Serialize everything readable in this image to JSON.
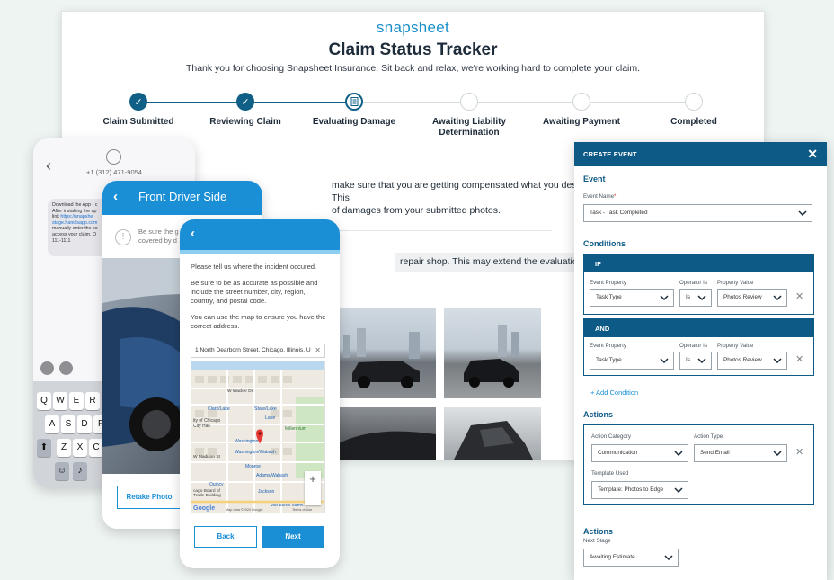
{
  "tracker": {
    "brand": "snapsheet",
    "title": "Claim Status Tracker",
    "subtitle": "Thank you for choosing Snapsheet Insurance. Sit back and relax, we're working hard to complete your claim.",
    "steps": [
      {
        "label": "Claim Submitted",
        "state": "done"
      },
      {
        "label": "Reviewing Claim",
        "state": "done"
      },
      {
        "label": "Evaluating Damage",
        "state": "active"
      },
      {
        "label": "Awaiting Liability Determination",
        "state": "todo"
      },
      {
        "label": "Awaiting Payment",
        "state": "todo"
      },
      {
        "label": "Completed",
        "state": "todo"
      }
    ],
    "body_line1": "make sure that you are getting compensated what you deserve. This",
    "body_line2": "of damages from your submitted photos.",
    "note": "repair shop. This may extend the evaluation period."
  },
  "sms_phone": {
    "number": "+1 (312) 471-9054",
    "message_a": "Download the App - c",
    "message_b": "After installing the ap",
    "message_c": "link ",
    "message_link1": "https://snapshe",
    "message_link2": "stage.handlsapp.com",
    "message_d": "manually enter the co",
    "message_e": "access your claim. Q",
    "message_f": "111-1111",
    "keys_row1": [
      "Q",
      "W",
      "E",
      "R"
    ],
    "keys_row2": [
      "A",
      "S",
      "D",
      "F"
    ],
    "keys_row3": [
      "Z",
      "X",
      "C"
    ]
  },
  "photo_phone": {
    "title": "Front Driver Side",
    "info_line1": "Be sure the g",
    "info_line2": "covered by d",
    "button": "Retake Photo"
  },
  "location_phone": {
    "para1": "Please tell us where the incident occured.",
    "para2": "Be sure to be as accurate as possible and include the street number, city, region, country, and postal code.",
    "para3": "You can use the map to ensure you have the correct address.",
    "address": "1 North Dearborn Street, Chicago, Illinois, U",
    "map_labels": {
      "wacker": "W Wacker Dr",
      "clark_lake": "Clark/Lake",
      "state_lake": "State/Lake",
      "lake": "Lake",
      "city_hall": "ity of Chicago City Hall",
      "millennium": "Millennium",
      "washington": "Washington",
      "washington_wabash": "Washington/Wabash",
      "madison": "W Madison St",
      "monroe": "Monroe",
      "adams_wabash": "Adams/Wabash",
      "quincy": "Quincy",
      "jackson": "Jackson",
      "board_of_trade": "cago Board of Trade Building",
      "van_buren": "Van Buren Street",
      "google": "Google",
      "map_data": "Map data ©2020 Google",
      "terms": "Terms of Use"
    },
    "back": "Back",
    "next": "Next"
  },
  "create_event": {
    "header": "CREATE EVENT",
    "event_section": "Event",
    "event_name_label": "Event Name",
    "event_name_value": "Task - Task Completed",
    "conditions_section": "Conditions",
    "if_label": "IF",
    "and_label": "AND",
    "event_property_label": "Event Property",
    "operator_label": "Operator Is",
    "property_value_label": "Property Value",
    "cond1": {
      "property": "Task Type",
      "operator": "Is",
      "value": "Photos Review"
    },
    "cond2": {
      "property": "Task Type",
      "operator": "Is",
      "value": "Photos Review"
    },
    "add_condition": "+ Add Condition",
    "actions_section": "Actions",
    "action_category_label": "Action Category",
    "action_type_label": "Action Type",
    "action_category_value": "Communication",
    "action_type_value": "Send Email",
    "template_label": "Template Used",
    "template_value": "Template: Photos to Edge",
    "actions2_section": "Actions",
    "next_stage_label": "Next Stage",
    "next_stage_value": "Awaiting Estimate"
  },
  "colors": {
    "brand_blue": "#1a8fd6",
    "navy": "#0e5a86",
    "background": "#eef4f2"
  }
}
